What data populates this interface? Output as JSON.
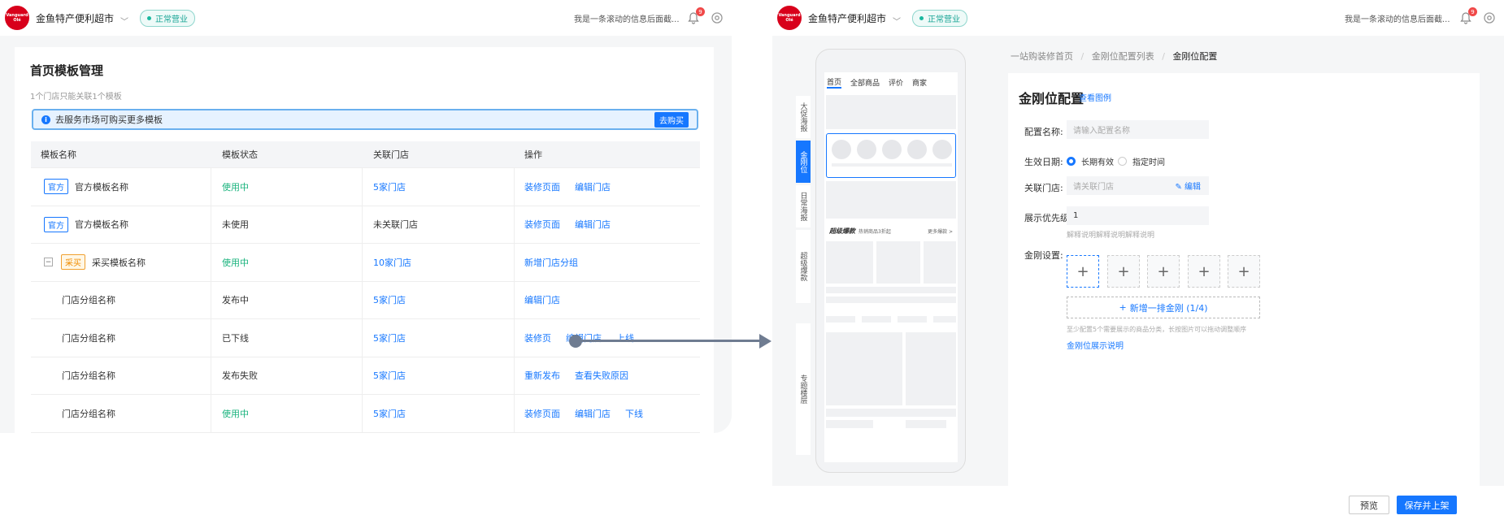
{
  "brand": {
    "logo_text": "Vanguard\nOlé",
    "store_name": "金鱼特产便利超市",
    "status": "正常营业",
    "scroll_msg": "我是一条滚动的信息后面截...",
    "notif_count": "9"
  },
  "left": {
    "title": "首页模板管理",
    "subtitle": "1个门店只能关联1个模板",
    "notice": "去服务市场可购买更多模板",
    "notice_btn": "去购买",
    "columns": [
      "模板名称",
      "模板状态",
      "关联门店",
      "操作"
    ],
    "rows": [
      {
        "tag": "官方",
        "name": "官方模板名称",
        "status": "使用中",
        "store": "5家门店",
        "ops": [
          "装修页面",
          "编辑门店"
        ]
      },
      {
        "tag": "官方",
        "name": "官方模板名称",
        "status": "未使用",
        "store": "未关联门店",
        "ops": [
          "装修页面",
          "编辑门店"
        ]
      },
      {
        "tag": "采买",
        "name": "采买模板名称",
        "status": "使用中",
        "store": "10家门店",
        "ops": [
          "新增门店分组"
        ]
      },
      {
        "name": "门店分组名称",
        "status": "发布中",
        "store": "5家门店",
        "ops": [
          "编辑门店"
        ]
      },
      {
        "name": "门店分组名称",
        "status": "已下线",
        "store": "5家门店",
        "ops": [
          "装修页",
          "编辑门店",
          "上线"
        ]
      },
      {
        "name": "门店分组名称",
        "status": "发布失败",
        "store": "5家门店",
        "ops": [
          "重新发布",
          "查看失败原因"
        ]
      },
      {
        "name": "门店分组名称",
        "status": "使用中",
        "store": "5家门店",
        "ops": [
          "装修页面",
          "编辑门店",
          "下线"
        ]
      }
    ]
  },
  "right": {
    "breadcrumbs": [
      "一站购装修首页",
      "金刚位配置列表",
      "金刚位配置"
    ],
    "side_tabs": [
      "大促海报",
      "金刚位",
      "日常海报",
      "超级爆款",
      "专题楼层"
    ],
    "phone_tabs": [
      "首页",
      "全部商品",
      "评价",
      "商家"
    ],
    "phone_banner": "超级爆款",
    "phone_banner_sub": "热销商品3折起",
    "phone_banner_more": "更多爆款 >",
    "title": "金刚位配置",
    "example_link": "查看图例",
    "name_label": "配置名称:",
    "name_placeholder": "请输入配置名称",
    "date_label": "生效日期:",
    "date_opt1": "长期有效",
    "date_opt2": "指定时间",
    "store_label": "关联门店:",
    "store_placeholder": "请关联门店",
    "store_edit": "编辑",
    "priority_label": "展示优先级:",
    "priority_value": "1",
    "priority_hint": "解释说明解释说明解释说明",
    "kingkong_label": "金刚设置:",
    "add_row": "新增一排金刚 (1/4)",
    "kingkong_hint": "至少配置5个需要展示的商品分类，长按图片可以拖动调整顺序",
    "kingkong_link": "金刚位展示说明",
    "preview_btn": "预览",
    "save_btn": "保存并上架"
  },
  "colors": {
    "primary": "#1677ff",
    "green": "#19b37d",
    "brand_red": "#d8001b",
    "arrow": "#6f7c91"
  }
}
